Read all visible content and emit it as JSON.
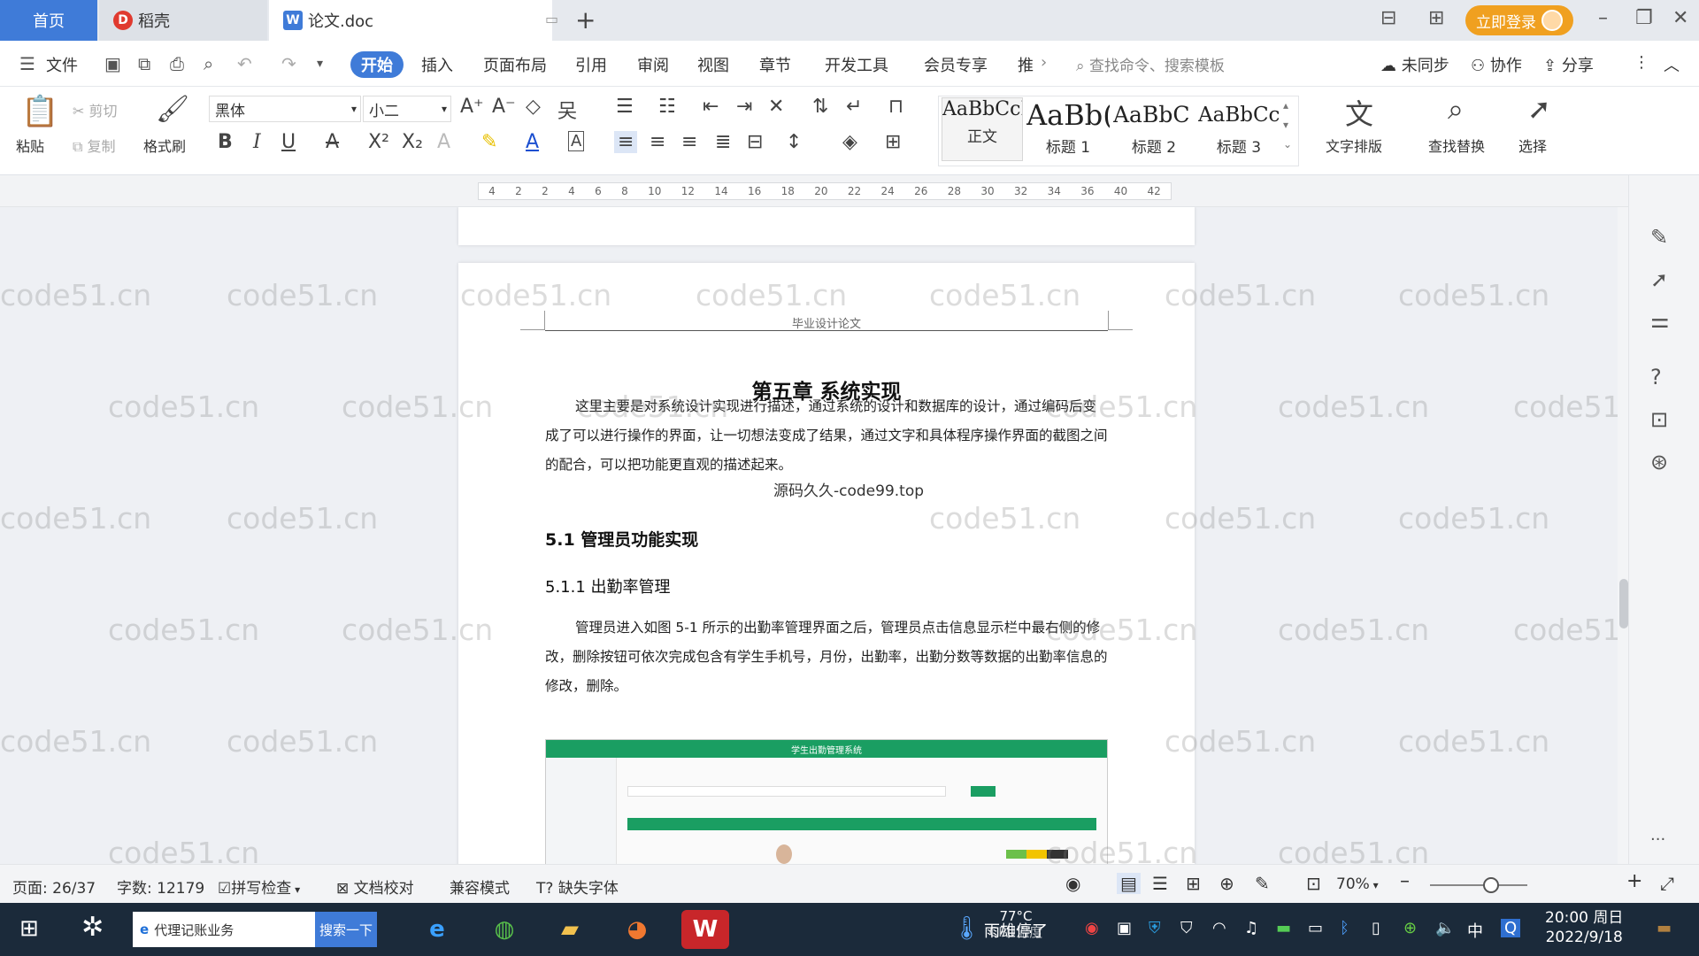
{
  "tabs": {
    "home": "首页",
    "daoke": "稻壳",
    "doc": "论文.doc",
    "doc_icon": "W",
    "daoke_icon": "D"
  },
  "titlebar": {
    "login": "立即登录"
  },
  "menu": {
    "file": "文件",
    "start": "开始",
    "items": [
      "插入",
      "页面布局",
      "引用",
      "审阅",
      "视图",
      "章节",
      "开发工具",
      "会员专享",
      "推"
    ],
    "search_cmd": "查找命令、搜索模板",
    "unsynced": "未同步",
    "collab": "协作",
    "share": "分享"
  },
  "ribbon": {
    "paste": "粘贴",
    "cut": "剪切",
    "copy": "复制",
    "format_painter": "格式刷",
    "font_name": "黑体",
    "font_size": "小二",
    "styles": [
      {
        "sample": "AaBbCcI",
        "name": "正文"
      },
      {
        "sample": "AaBb(",
        "name": "标题 1"
      },
      {
        "sample": "AaBbC",
        "name": "标题 2"
      },
      {
        "sample": "AaBbCc",
        "name": "标题 3"
      }
    ],
    "text_layout": "文字排版",
    "find_replace": "查找替换",
    "select": "选择"
  },
  "ruler": {
    "marks": [
      "4",
      "2",
      "2",
      "4",
      "6",
      "8",
      "10",
      "12",
      "14",
      "16",
      "18",
      "20",
      "22",
      "24",
      "26",
      "28",
      "30",
      "32",
      "34",
      "36",
      "40",
      "42"
    ]
  },
  "document": {
    "header": "毕业设计论文",
    "chapter_title": "第五章  系统实现",
    "intro": "这里主要是对系统设计实现进行描述，通过系统的设计和数据库的设计，通过编码后变成了可以进行操作的界面，让一切想法变成了结果，通过文字和具体程序操作界面的截图之间的配合，可以把功能更直观的描述起来。",
    "overlay_watermark": "源码久久-code99.top",
    "section": "5.1 管理员功能实现",
    "subsection": "5.1.1  出勤率管理",
    "body": "管理员进入如图 5-1 所示的出勤率管理界面之后，管理员点击信息显示栏中最右侧的修改，删除按钮可依次完成包含有学生手机号，月份，出勤率，出勤分数等数据的出勤率信息的修改，删除。",
    "screenshot_title": "学生出勤管理系统"
  },
  "watermark": "code51.cn",
  "statusbar": {
    "page": "页面: 26/37",
    "words": "字数: 12179",
    "spell": "拼写检查",
    "doc_check": "文档校对",
    "compat": "兼容模式",
    "missing_font": "缺失字体",
    "zoom": "70%"
  },
  "taskbar": {
    "search_text": "代理记账业务",
    "search_btn": "搜索一下",
    "weather_temp": "77°C",
    "weather_text": "雨雄停了",
    "weather_sub": "CPU温度",
    "ime": "中",
    "time": "20:00 周日",
    "date": "2022/9/18"
  },
  "colors": {
    "accent": "#3f7bd8",
    "login": "#f0a020",
    "wps_red": "#e03a2f",
    "screenshot_green": "#1a9e62"
  }
}
